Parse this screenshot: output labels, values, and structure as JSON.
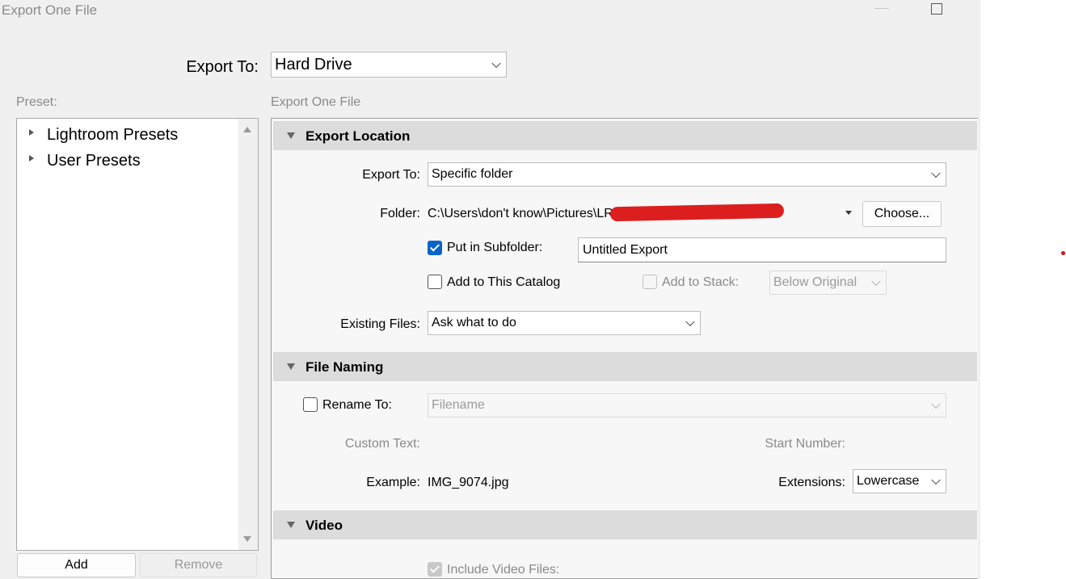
{
  "window": {
    "title": "Export One File"
  },
  "header": {
    "export_to_label": "Export To:",
    "export_to_value": "Hard Drive"
  },
  "preset": {
    "label": "Preset:",
    "items": [
      {
        "label": "Lightroom Presets"
      },
      {
        "label": "User Presets"
      }
    ],
    "add_label": "Add",
    "remove_label": "Remove"
  },
  "panel": {
    "title": "Export One File"
  },
  "export_location": {
    "title": "Export Location",
    "export_to_label": "Export To:",
    "export_to_value": "Specific folder",
    "folder_label": "Folder:",
    "folder_path": "C:\\Users\\don't know\\Pictures\\LR",
    "choose_label": "Choose...",
    "subfolder_label": "Put in Subfolder:",
    "subfolder_checked": true,
    "subfolder_value": "Untitled Export",
    "add_catalog_label": "Add to This Catalog",
    "add_catalog_checked": false,
    "add_stack_label": "Add to Stack:",
    "add_stack_checked": false,
    "stack_position_value": "Below Original",
    "existing_files_label": "Existing Files:",
    "existing_files_value": "Ask what to do"
  },
  "file_naming": {
    "title": "File Naming",
    "rename_label": "Rename To:",
    "rename_checked": false,
    "rename_value": "Filename",
    "custom_text_label": "Custom Text:",
    "start_number_label": "Start Number:",
    "example_label": "Example:",
    "example_value": "IMG_9074.jpg",
    "extensions_label": "Extensions:",
    "extensions_value": "Lowercase"
  },
  "video": {
    "title": "Video",
    "include_label": "Include Video Files:",
    "include_checked": true
  },
  "colors": {
    "accent": "#0a64c8",
    "section_header": "#dcdcdc",
    "redaction": "#dd1e1e"
  }
}
